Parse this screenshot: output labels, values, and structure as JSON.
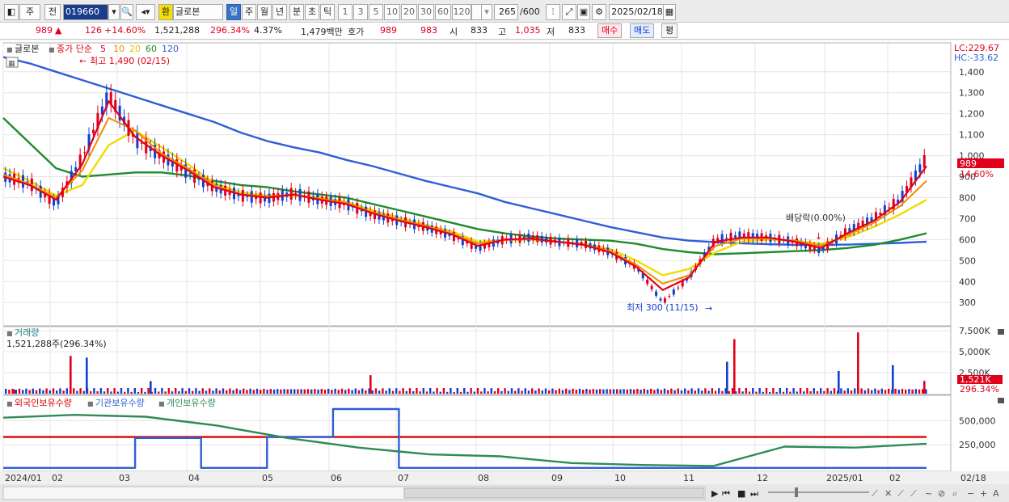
{
  "toolbar": {
    "type_select": "주",
    "prev_label": "전",
    "stock_code": "019660",
    "stock_name": "글로본",
    "hwan_label": "환",
    "period_tabs": [
      "일",
      "주",
      "월",
      "년",
      "분",
      "초",
      "틱"
    ],
    "period_active": "일",
    "minute_tabs": [
      "1",
      "3",
      "5",
      "10",
      "20",
      "30",
      "60",
      "120"
    ],
    "bar_count": "265",
    "bar_total": "/600",
    "date": "2025/02/18"
  },
  "quote": {
    "price": "989",
    "change": "126",
    "change_pct": "+14.60%",
    "volume": "1,521,288",
    "volume_ratio": "296.34%",
    "turnover": "4.37%",
    "amount": "1,479백만",
    "hoga_label": "호가",
    "ask": "989",
    "bid": "983",
    "open_label": "시",
    "open": "833",
    "high_label": "고",
    "high": "1,035",
    "low_label": "저",
    "low": "833",
    "buy_label": "매수",
    "sell_label": "매도",
    "avg_label": "평"
  },
  "colors": {
    "up": "#e0001a",
    "down": "#1040d0",
    "ma5": "#e0001a",
    "ma10": "#f08c00",
    "ma20": "#f0dc00",
    "ma60": "#1e8c2c",
    "ma120": "#2f5ed6",
    "foreign": "#e00000",
    "institution": "#2f5ed6",
    "individual": "#2e8b57"
  },
  "price_panel": {
    "title": "글로본",
    "legend_prefix": "종가 단순",
    "ma_periods": [
      "5",
      "10",
      "20",
      "60",
      "120"
    ],
    "lc_label": "LC:229.67",
    "hc_label": "HC:-33.62",
    "current_price_tag": "989",
    "current_change_tag": "14.60%",
    "high_annotation": "최고 1,490 (02/15)",
    "low_annotation": "최저 300 (11/15)",
    "dividend_annotation": "배당락(0.00%)"
  },
  "volume_panel": {
    "title": "거래량",
    "info": "1,521,288주(296.34%)",
    "current_tag": "1,521K",
    "current_pct_tag": "296.34%"
  },
  "holding_panel": {
    "legend": [
      "외국인보유수량",
      "기관보유수량",
      "개인보유수량"
    ]
  },
  "x_axis_labels": [
    "2024/01",
    "02",
    "03",
    "04",
    "05",
    "06",
    "07",
    "08",
    "09",
    "10",
    "11",
    "12",
    "2025/01",
    "02",
    "02/18"
  ],
  "chart_data": [
    {
      "type": "candlestick",
      "title": "글로본",
      "y_tick_labels": [
        "300",
        "400",
        "500",
        "600",
        "700",
        "800",
        "900",
        "1,000",
        "1,100",
        "1,200",
        "1,300",
        "1,400"
      ],
      "ylim": [
        220,
        1480
      ],
      "months": [
        "2024/01",
        "02",
        "03",
        "04",
        "05",
        "06",
        "07",
        "08",
        "09",
        "10",
        "11",
        "12",
        "2025/01",
        "02"
      ],
      "series": [
        {
          "name": "종가",
          "values": [
            900,
            870,
            770,
            990,
            1290,
            1080,
            1000,
            920,
            850,
            810,
            795,
            820,
            790,
            770,
            720,
            690,
            660,
            620,
            560,
            600,
            610,
            590,
            580,
            540,
            470,
            300,
            420,
            600,
            620,
            610,
            590,
            550,
            640,
            700,
            790,
            989
          ]
        },
        {
          "name": "5",
          "values": [
            900,
            860,
            790,
            960,
            1260,
            1090,
            1000,
            930,
            850,
            815,
            800,
            815,
            790,
            770,
            725,
            690,
            660,
            625,
            570,
            600,
            605,
            590,
            575,
            540,
            470,
            360,
            420,
            590,
            610,
            610,
            590,
            560,
            630,
            690,
            780,
            950
          ]
        },
        {
          "name": "10",
          "values": [
            910,
            865,
            800,
            930,
            1180,
            1120,
            1010,
            940,
            860,
            815,
            805,
            815,
            795,
            775,
            730,
            695,
            665,
            630,
            580,
            598,
            603,
            590,
            575,
            545,
            480,
            390,
            430,
            570,
            605,
            605,
            595,
            570,
            620,
            680,
            760,
            880
          ]
        },
        {
          "name": "20",
          "values": [
            940,
            880,
            810,
            860,
            1050,
            1120,
            1040,
            960,
            870,
            825,
            810,
            810,
            800,
            780,
            740,
            705,
            670,
            640,
            590,
            597,
            600,
            590,
            580,
            555,
            500,
            430,
            460,
            540,
            590,
            600,
            595,
            580,
            610,
            660,
            720,
            790
          ]
        },
        {
          "name": "60",
          "values": [
            1180,
            1060,
            940,
            900,
            910,
            920,
            920,
            905,
            880,
            860,
            850,
            830,
            815,
            800,
            770,
            740,
            710,
            680,
            650,
            630,
            615,
            605,
            600,
            595,
            580,
            555,
            540,
            530,
            535,
            540,
            545,
            550,
            560,
            575,
            600,
            630
          ]
        },
        {
          "name": "120",
          "values": [
            1470,
            1440,
            1400,
            1360,
            1320,
            1280,
            1240,
            1200,
            1160,
            1110,
            1070,
            1040,
            1015,
            980,
            950,
            915,
            880,
            850,
            820,
            780,
            750,
            720,
            690,
            660,
            635,
            610,
            595,
            588,
            582,
            578,
            575,
            575,
            576,
            580,
            584,
            590
          ]
        }
      ]
    },
    {
      "type": "bar",
      "title": "거래량",
      "y_tick_labels": [
        "2,500K",
        "5,000K",
        "7,500K"
      ],
      "ylim": [
        0,
        7800000
      ],
      "spikes": [
        {
          "month": "2024/01",
          "value": 500000
        },
        {
          "month": "02",
          "value": 4300000
        },
        {
          "month": "02",
          "value": 4500000
        },
        {
          "month": "03",
          "value": 1500000
        },
        {
          "month": "06",
          "value": 2200000
        },
        {
          "month": "11",
          "value": 3800000
        },
        {
          "month": "11",
          "value": 6500000
        },
        {
          "month": "2025/01",
          "value": 2700000
        },
        {
          "month": "2025/01",
          "value": 7300000
        },
        {
          "month": "02",
          "value": 3400000
        },
        {
          "month": "02",
          "value": 1521288
        }
      ]
    },
    {
      "type": "line",
      "title": "보유수량",
      "y_tick_labels": [
        "250,000",
        "500,000"
      ],
      "ylim": [
        0,
        620000
      ],
      "series": [
        {
          "name": "외국인보유수량",
          "values": [
            330000,
            330000,
            330000,
            330000,
            330000,
            330000,
            330000,
            330000,
            330000,
            330000,
            330000,
            330000,
            330000,
            330000
          ]
        },
        {
          "name": "기관보유수량",
          "values": [
            10000,
            10000,
            320000,
            10000,
            330000,
            620000,
            10000,
            10000,
            10000,
            10000,
            10000,
            10000,
            10000,
            10000
          ]
        },
        {
          "name": "개인보유수량",
          "values": [
            530000,
            560000,
            540000,
            450000,
            320000,
            220000,
            150000,
            130000,
            60000,
            40000,
            30000,
            230000,
            220000,
            260000
          ]
        }
      ]
    }
  ]
}
